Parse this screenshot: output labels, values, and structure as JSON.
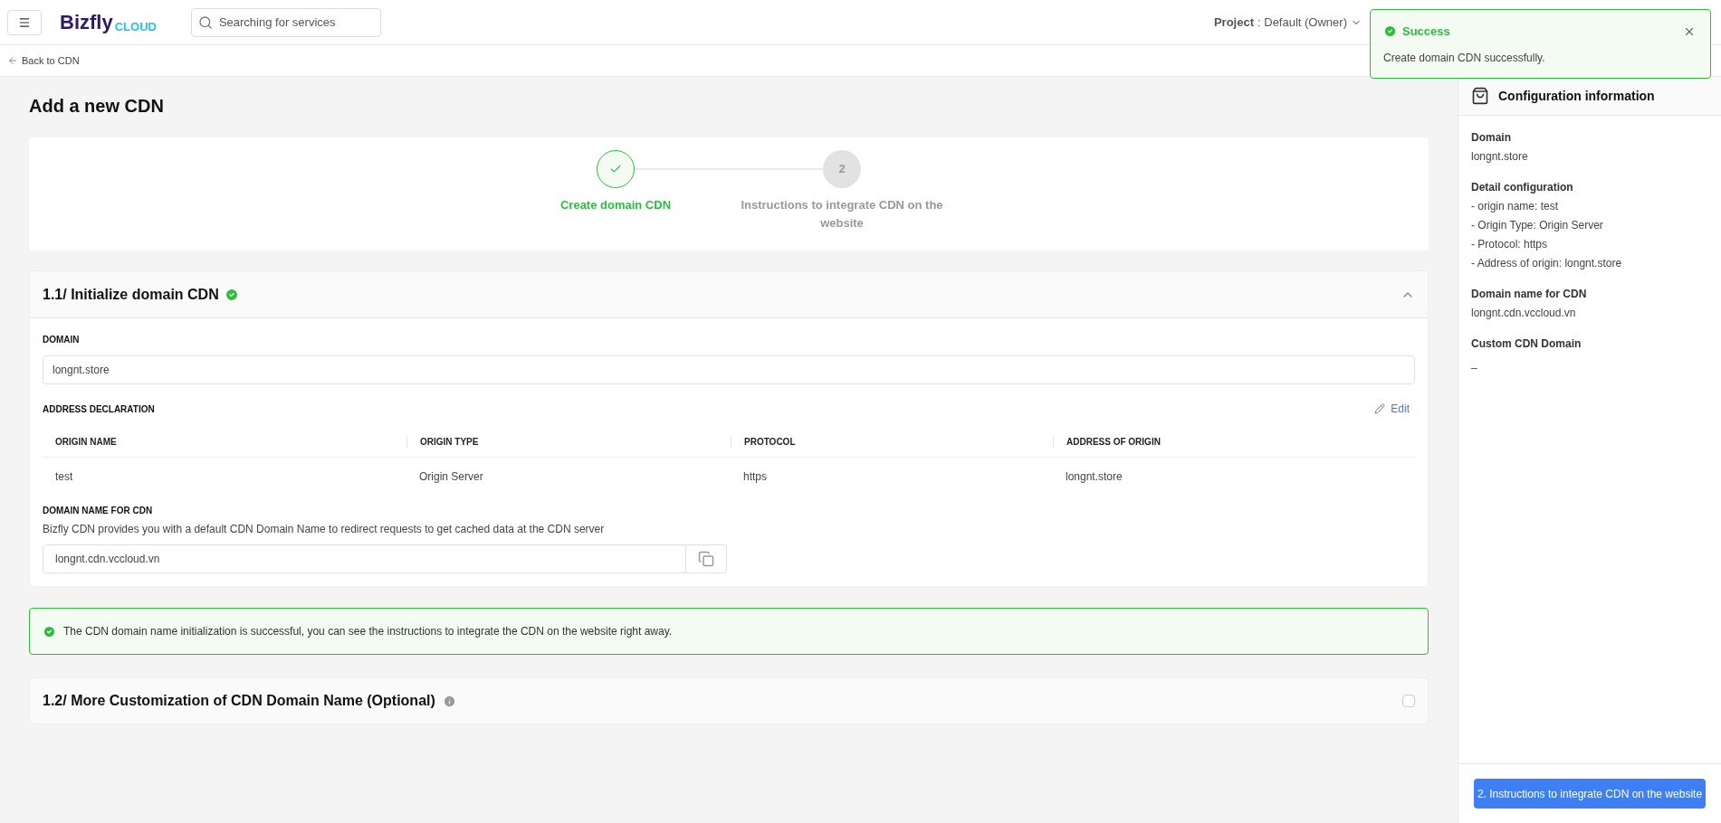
{
  "header": {
    "logo_main": "Bizfly",
    "logo_sub": "CLOUD",
    "search": {
      "placeholder": "Searching for services"
    },
    "project_label": "Project",
    "project_value": " : Default (Owner)"
  },
  "back_link": "Back to CDN",
  "page_title": "Add a new CDN",
  "steps": [
    {
      "label": "Create domain CDN",
      "done": true
    },
    {
      "marker": "2",
      "label": "Instructions to integrate CDN on the website",
      "done": false
    }
  ],
  "section1": {
    "title": "1.1/ Initialize domain CDN",
    "completed": true,
    "expanded": true,
    "domain_label": "DOMAIN",
    "domain_value": "longnt.store",
    "address_label": "ADDRESS DECLARATION",
    "edit": "Edit",
    "columns": [
      "ORIGIN NAME",
      "ORIGIN TYPE",
      "PROTOCOL",
      "ADDRESS OF ORIGIN"
    ],
    "rows": [
      [
        "test",
        "Origin Server",
        "https",
        "longnt.store"
      ]
    ],
    "cdn_label": "DOMAIN NAME FOR CDN",
    "cdn_help": "Bizfly CDN provides you with a default CDN Domain Name to redirect requests to get cached data at the CDN server",
    "cdn_value": "longnt.cdn.vccloud.vn"
  },
  "alert": "The CDN domain name initialization is successful, you can see the instructions to integrate the CDN on the website right away.",
  "section2": {
    "title": "1.2/ More Customization of CDN Domain Name (Optional)",
    "checked": false
  },
  "panel": {
    "title": "Configuration information",
    "groups": [
      {
        "heading": "Domain",
        "lines": [
          "longnt.store"
        ]
      },
      {
        "heading": "Detail configuration",
        "lines": [
          "- origin name: test",
          "- Origin Type: Origin Server",
          "- Protocol: https",
          "- Address of origin: longnt.store"
        ]
      },
      {
        "heading": "Domain name for CDN",
        "lines": [
          "longnt.cdn.vccloud.vn"
        ]
      },
      {
        "heading": "Custom CDN Domain",
        "lines": [
          "_"
        ]
      }
    ],
    "button": "2. Instructions to integrate CDN on the website"
  },
  "toast": {
    "title": "Success",
    "message": "Create domain CDN successfully."
  }
}
